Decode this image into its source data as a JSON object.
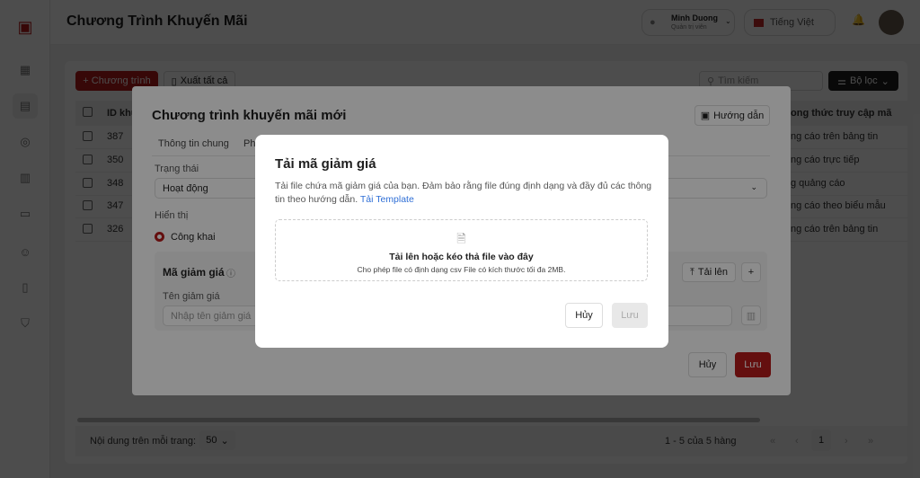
{
  "header": {
    "title": "Chương Trình Khuyến Mãi",
    "user_name": "Minh Duong",
    "user_role": "Quản trị viên",
    "language": "Tiếng Việt"
  },
  "sidebar": {
    "items": [
      "dashboard-icon",
      "document-icon",
      "compass-icon",
      "chart-icon",
      "briefcase-icon",
      "users-icon",
      "invoice-icon",
      "shield-icon"
    ],
    "active_index": 1
  },
  "toolbar": {
    "add_label": "+ Chương trình",
    "export_label": "Xuất tất cả",
    "search_placeholder": "Tìm kiếm",
    "filter_label": "Bộ lọc"
  },
  "table": {
    "columns": {
      "id": "ID khu",
      "access": "ong thức truy cập mã"
    },
    "rows": [
      {
        "id": "387",
        "access": "ng cáo trên bảng tin"
      },
      {
        "id": "350",
        "access": "ng cáo trực tiếp"
      },
      {
        "id": "348",
        "access": "g quảng cáo"
      },
      {
        "id": "347",
        "access": "ng cáo theo biểu mẫu"
      },
      {
        "id": "326",
        "access": "ng cáo trên bảng tin"
      }
    ]
  },
  "footer": {
    "per_page_label": "Nội dung trên mỗi trang:",
    "per_page": "50",
    "range": "1 - 5 của 5 hàng",
    "page": "1"
  },
  "modal1": {
    "title": "Chương trình khuyến mãi mới",
    "guide": "Hướng dẫn",
    "tabs": [
      "Thông tin chung",
      "Ph"
    ],
    "status_label": "Trạng thái",
    "status_value": "Hoạt động",
    "display_label": "Hiển thị",
    "display_value": "Công khai",
    "coupon_section": "Mã giảm giá",
    "upload": "Tải lên",
    "add": "+",
    "coupon_name_label": "Tên giảm giá",
    "coupon_name_placeholder": "Nhập tên giảm giá",
    "cancel": "Hủy",
    "save": "Lưu"
  },
  "modal2": {
    "title": "Tải mã giảm giá",
    "description": "Tải file chứa mã giảm giá của bạn. Đảm bảo rằng file đúng định dạng và đầy đủ các thông tin theo hướng dẫn.",
    "template_link": "Tải Template",
    "drop_title": "Tải lên hoặc kéo thả file vào đây",
    "drop_hint": "Cho phép file có định dạng csv File có kích thước tối đa 2MB.",
    "cancel": "Hủy",
    "save": "Lưu"
  },
  "colors": {
    "accent": "#b71c1c",
    "link": "#2f6fd6"
  }
}
